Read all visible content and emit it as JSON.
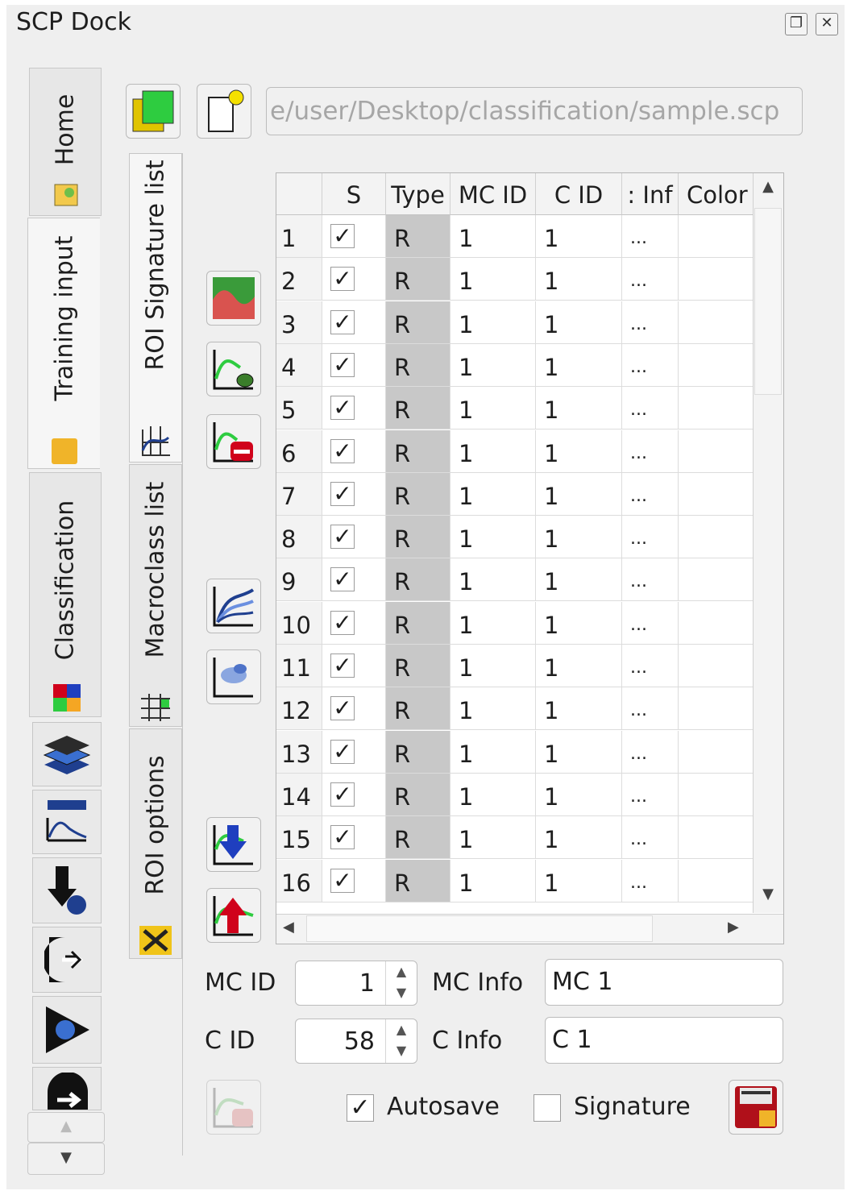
{
  "dock": {
    "title": "SCP Dock",
    "float_icon": "float-icon",
    "close_icon": "close-icon"
  },
  "left_tabs": {
    "home": "Home",
    "training_input": "Training input",
    "classification": "Classification"
  },
  "inner_tabs": {
    "roi_signature_list": "ROI Signature list",
    "macroclass_list": "Macroclass list",
    "roi_options": "ROI options"
  },
  "toolbar": {
    "path": "e/user/Desktop/classification/sample.scp",
    "new_file_icon": "new-training-input-icon",
    "open_file_icon": "open-training-input-icon"
  },
  "table": {
    "headers": [
      "S",
      "Type",
      "MC ID",
      "C ID",
      ": Inf",
      "Color"
    ],
    "rows": [
      {
        "n": "1",
        "s": "✓",
        "type": "R",
        "mc": "1",
        "c": "1",
        "info": "..."
      },
      {
        "n": "2",
        "s": "✓",
        "type": "R",
        "mc": "1",
        "c": "1",
        "info": "..."
      },
      {
        "n": "3",
        "s": "✓",
        "type": "R",
        "mc": "1",
        "c": "1",
        "info": "..."
      },
      {
        "n": "4",
        "s": "✓",
        "type": "R",
        "mc": "1",
        "c": "1",
        "info": "..."
      },
      {
        "n": "5",
        "s": "✓",
        "type": "R",
        "mc": "1",
        "c": "1",
        "info": "..."
      },
      {
        "n": "6",
        "s": "✓",
        "type": "R",
        "mc": "1",
        "c": "1",
        "info": "..."
      },
      {
        "n": "7",
        "s": "✓",
        "type": "R",
        "mc": "1",
        "c": "1",
        "info": "..."
      },
      {
        "n": "8",
        "s": "✓",
        "type": "R",
        "mc": "1",
        "c": "1",
        "info": "..."
      },
      {
        "n": "9",
        "s": "✓",
        "type": "R",
        "mc": "1",
        "c": "1",
        "info": "..."
      },
      {
        "n": "10",
        "s": "✓",
        "type": "R",
        "mc": "1",
        "c": "1",
        "info": "..."
      },
      {
        "n": "11",
        "s": "✓",
        "type": "R",
        "mc": "1",
        "c": "1",
        "info": "..."
      },
      {
        "n": "12",
        "s": "✓",
        "type": "R",
        "mc": "1",
        "c": "1",
        "info": "..."
      },
      {
        "n": "13",
        "s": "✓",
        "type": "R",
        "mc": "1",
        "c": "1",
        "info": "..."
      },
      {
        "n": "14",
        "s": "✓",
        "type": "R",
        "mc": "1",
        "c": "1",
        "info": "..."
      },
      {
        "n": "15",
        "s": "✓",
        "type": "R",
        "mc": "1",
        "c": "1",
        "info": "..."
      },
      {
        "n": "16",
        "s": "✓",
        "type": "R",
        "mc": "1",
        "c": "1",
        "info": "..."
      }
    ]
  },
  "form": {
    "mc_id_label": "MC ID",
    "mc_id_value": "1",
    "mc_info_label": "MC Info",
    "mc_info_value": "MC 1",
    "c_id_label": "C ID",
    "c_id_value": "58",
    "c_info_label": "C Info",
    "c_info_value": "C 1",
    "autosave_label": "Autosave",
    "autosave_checked": "✓",
    "signature_label": "Signature"
  },
  "colors": {
    "panel": "#efefef",
    "type_col": "#c8c8c8",
    "accent_green": "#2ecc40",
    "accent_red": "#d0021b",
    "accent_blue": "#1f3fbf"
  }
}
